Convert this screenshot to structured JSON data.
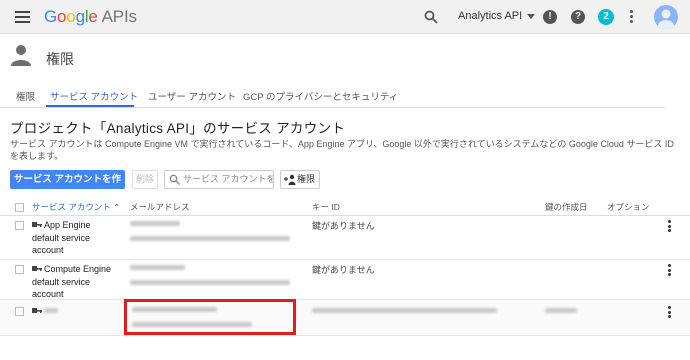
{
  "appbar": {
    "logo_letters": [
      "G",
      "o",
      "o",
      "g",
      "l",
      "e"
    ],
    "logo_suffix": "APIs",
    "project": "Analytics API",
    "notification_count": "2",
    "colors": {
      "logo_blue": "#4285f4",
      "logo_red": "#ea4335",
      "logo_yellow": "#fbbc05",
      "logo_green": "#34a853",
      "badge": "#00bcd4"
    }
  },
  "page": {
    "title": "権限"
  },
  "tabs": [
    {
      "label": "権限"
    },
    {
      "label": "サービス アカウント"
    },
    {
      "label": "ユーザー アカウント"
    },
    {
      "label": "GCP のプライバシーとセキュリティ"
    }
  ],
  "heading": "プロジェクト「Analytics API」のサービス アカウント",
  "description": "サービス アカウントは Compute Engine VM で実行されているコード、App Engine アプリ、Google 以外で実行されているシステムなどの Google Cloud サービス ID を表します。",
  "toolbar": {
    "create_label": "サービス アカウントを作成",
    "delete_label": "削除",
    "search_placeholder": "サービス アカウントを",
    "permissions_label": "権限"
  },
  "table": {
    "headers": {
      "name": "サービス アカウント",
      "email": "メールアドレス",
      "key_id": "キー ID",
      "key_created": "鍵の作成日",
      "options": "オプション"
    },
    "rows": [
      {
        "name_lines": [
          "App Engine",
          "default service",
          "account"
        ],
        "key_id": "鍵がありません"
      },
      {
        "name_lines": [
          "Compute Engine",
          "default service",
          "account"
        ],
        "key_id": "鍵がありません"
      },
      {
        "name_lines": [],
        "key_id": ""
      }
    ]
  },
  "accent_color": "#3367d6",
  "primary_button_color": "#4285f4",
  "highlight_color": "#e11d1d"
}
